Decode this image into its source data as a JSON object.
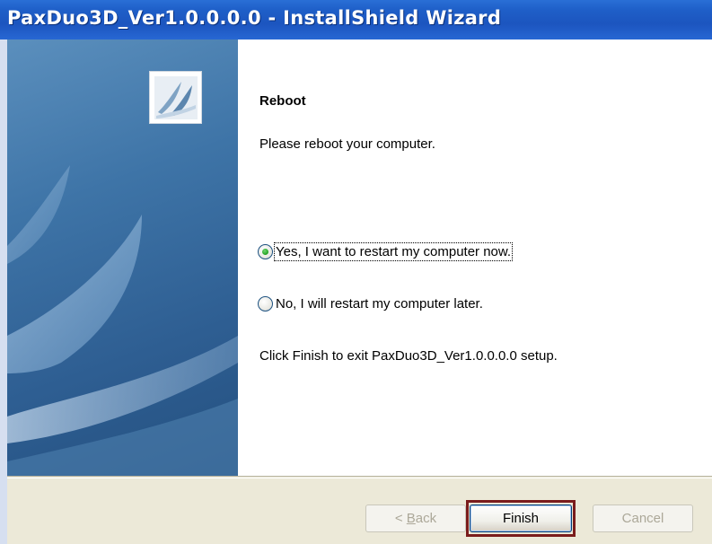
{
  "window": {
    "title": "PaxDuo3D_Ver1.0.0.0.0 - InstallShield Wizard"
  },
  "content": {
    "heading": "Reboot",
    "intro": "Please reboot your computer.",
    "options": [
      {
        "label": "Yes, I want to restart my computer now.",
        "selected": true
      },
      {
        "label": "No, I will restart my computer later.",
        "selected": false
      }
    ],
    "finish_note": "Click Finish to exit PaxDuo3D_Ver1.0.0.0.0 setup."
  },
  "buttons": {
    "back_prefix": "< ",
    "back_mnemonic": "B",
    "back_rest": "ack",
    "finish": "Finish",
    "cancel": "Cancel"
  },
  "colors": {
    "titlebar": "#1f5fc8",
    "panel": "#3e74a7",
    "button_area": "#ece9d8",
    "finish_highlight": "#7a1c1c"
  }
}
